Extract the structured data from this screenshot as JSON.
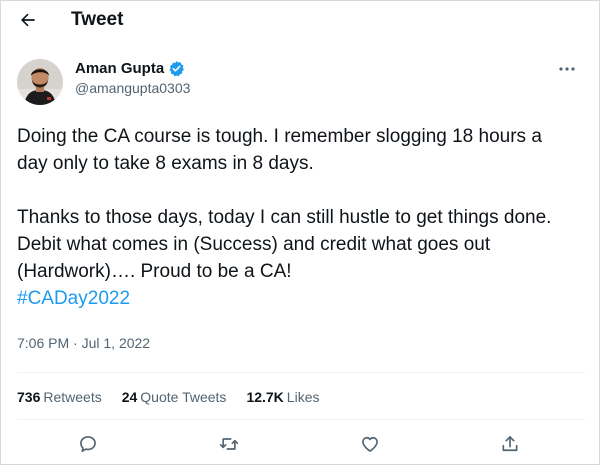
{
  "header": {
    "title": "Tweet",
    "back_icon": "arrow-left-icon"
  },
  "author": {
    "name": "Aman Gupta",
    "handle": "@amangupta0303",
    "verified": true,
    "verified_color": "#1d9bf0"
  },
  "tweet": {
    "paragraph1": "Doing the CA course is tough. I remember slogging 18 hours a day only to take 8 exams in 8 days.",
    "paragraph2": "Thanks to those days, today I can still hustle to get things done. Debit what comes in (Success) and credit what goes out (Hardwork)…. Proud to be a CA!",
    "hashtag": "#CADay2022",
    "time": "7:06 PM",
    "separator": "·",
    "date": "Jul 1, 2022"
  },
  "stats": {
    "retweets_count": "736",
    "retweets_label": "Retweets",
    "quote_tweets_count": "24",
    "quote_tweets_label": "Quote Tweets",
    "likes_count": "12.7K",
    "likes_label": "Likes"
  },
  "actions": [
    "reply-icon",
    "retweet-icon",
    "like-icon",
    "share-icon"
  ],
  "colors": {
    "text": "#0f1419",
    "secondary": "#536471",
    "accent": "#1d9bf0",
    "border": "#eff3f4"
  }
}
